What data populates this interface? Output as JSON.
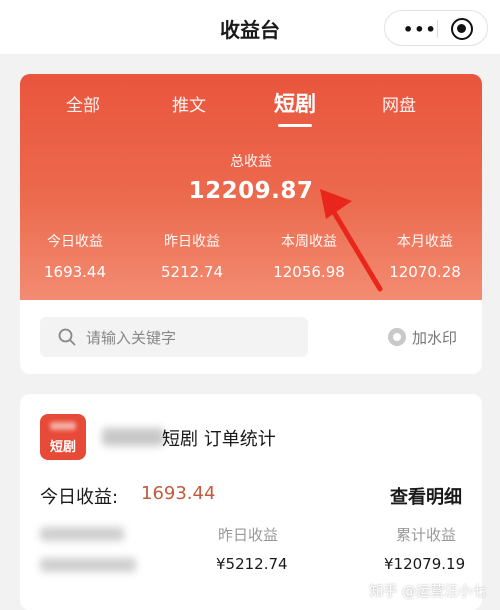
{
  "nav": {
    "title": "收益台",
    "more_glyph": "•••"
  },
  "tabs": [
    {
      "label": "全部",
      "active": false
    },
    {
      "label": "推文",
      "active": false
    },
    {
      "label": "短剧",
      "active": true
    },
    {
      "label": "网盘",
      "active": false
    }
  ],
  "summary": {
    "total_label": "总收益",
    "total_value": "12209.87",
    "stats": [
      {
        "label": "今日收益",
        "value": "1693.44"
      },
      {
        "label": "昨日收益",
        "value": "5212.74"
      },
      {
        "label": "本周收益",
        "value": "12056.98"
      },
      {
        "label": "本月收益",
        "value": "12070.28"
      }
    ]
  },
  "search": {
    "placeholder": "请输入关键字",
    "watermark_label": "加水印"
  },
  "order_card": {
    "logo_label": "短剧",
    "title": "短剧 订单统计",
    "today_label": "今日收益:",
    "today_value": "1693.44",
    "detail_link": "查看明细",
    "columns": [
      {
        "label": "昨日收益",
        "value": "¥5212.74"
      },
      {
        "label": "累计收益",
        "value": "¥12079.19"
      }
    ]
  },
  "footer_watermark": "知乎 @运营汪小七",
  "colors": {
    "accent": "#e9553d",
    "arrow": "#e8261c",
    "today_value": "#c25b3d"
  },
  "icons": {
    "search": "search-icon",
    "watermark": "watermark-toggle-icon",
    "more": "more-icon",
    "close": "mini-program-close-icon",
    "annotation": "red-arrow-icon"
  }
}
